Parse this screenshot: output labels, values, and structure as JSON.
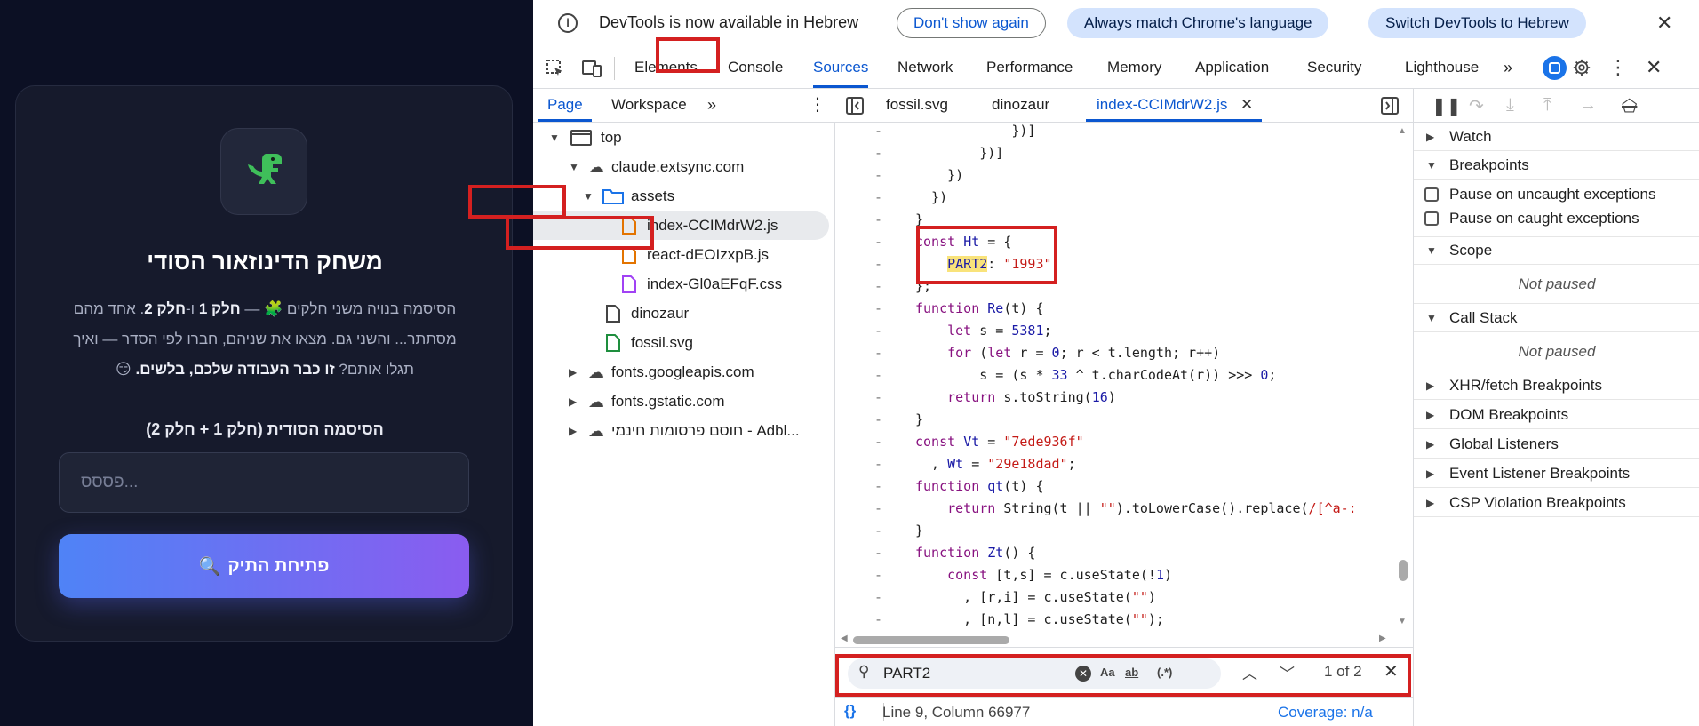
{
  "game": {
    "title": "משחק הדינוזאור הסודי",
    "desc_line1": "הסיסמה בנויה משני חלקים 🧩 — ",
    "desc_part1": "חלק 1",
    "desc_and": " ו-",
    "desc_part2": "חלק 2",
    "desc_line1_end": ". אחד מהם",
    "desc_line2": "מסתתר... והשני גם. מצאו את שניהם, חברו לפי הסדר — ואיך",
    "desc_line3_start": "תגלו אותם? ",
    "desc_bold": "זו כבר העבודה שלכם, בלשים.",
    "desc_emoji": " 😏",
    "pw_label": "הסיסמה הסודית (חלק 1 + חלק 2)",
    "pw_placeholder": "פססס...",
    "button_label": "פתיחת התיק",
    "button_icon": "🔍"
  },
  "infobar": {
    "text": "DevTools is now available in Hebrew",
    "dont_show": "Don't show again",
    "always_match": "Always match Chrome's language",
    "switch": "Switch DevTools to Hebrew"
  },
  "tabs": [
    "Elements",
    "Console",
    "Sources",
    "Network",
    "Performance",
    "Memory",
    "Application",
    "Security",
    "Lighthouse"
  ],
  "active_tab": "Sources",
  "nav_tabs": {
    "page": "Page",
    "workspace": "Workspace"
  },
  "tree": {
    "top": "top",
    "domain": "claude.extsync.com",
    "assets": "assets",
    "file_index_js": "index-CCIMdrW2.js",
    "file_react": "react-dEOIzxpB.js",
    "file_css": "index-Gl0aEFqF.css",
    "file_dinozaur": "dinozaur",
    "file_fossil": "fossil.svg",
    "fonts_googleapis": "fonts.googleapis.com",
    "fonts_gstatic": "fonts.gstatic.com",
    "adblock": "חוסם פרסומות חינמי - Adbl..."
  },
  "editor_tabs": [
    "fossil.svg",
    "dinozaur",
    "index-CCIMdrW2.js"
  ],
  "code": {
    "l1": "            })]",
    "l2": "        })]",
    "l3": "    })",
    "l4": "  })",
    "l5": "}",
    "l6_kw": "const",
    "l6_var": "Ht",
    "l6_rest": " = {",
    "l7_key": "PART2",
    "l7_val": "\"1993\"",
    "l8": "};",
    "l9_kw": "function",
    "l9_name": "Re",
    "l9_rest": "(t) {",
    "l10_kw": "let",
    "l10_rest": " s = ",
    "l10_num": "5381",
    "l11_kw": "for",
    "l11_rest1": " (",
    "l11_kw2": "let",
    "l11_rest2": " r = ",
    "l11_num": "0",
    "l11_rest3": "; r < t.length; r++)",
    "l12_rest1": "s = (s * ",
    "l12_num": "33",
    "l12_rest2": " ^ t.charCodeAt(r)) >>> ",
    "l12_num2": "0",
    "l12_end": ";",
    "l13_kw": "return",
    "l13_rest1": " s.toString(",
    "l13_num": "16",
    "l13_end": ")",
    "l14": "}",
    "l15_kw": "const",
    "l15_var": "Vt",
    "l15_rest": " = ",
    "l15_str": "\"7ede936f\"",
    "l16_rest": "  , ",
    "l16_var": "Wt",
    "l16_rest2": " = ",
    "l16_str": "\"29e18dad\"",
    "l16_end": ";",
    "l17_kw": "function",
    "l17_name": "qt",
    "l17_rest": "(t) {",
    "l18_kw": "return",
    "l18_rest": " String(t || ",
    "l18_str": "\"\"",
    "l18_rest2": ").toLowerCase().replace(",
    "l18_re": "/[^a-:",
    "l19": "}",
    "l20_kw": "function",
    "l20_name": "Zt",
    "l20_rest": "() {",
    "l21_kw": "const",
    "l21_rest": " [t,s] = c.useState(!",
    "l21_num": "1",
    "l21_end": ")",
    "l22_rest": "  , [r,i] = c.useState(",
    "l22_str": "\"\"",
    "l22_end": ")",
    "l23_rest": "  , [n,l] = c.useState(",
    "l23_str": "\"\"",
    "l23_end": ");"
  },
  "search": {
    "query": "PART2",
    "aa": "Aa",
    "ab": "ab",
    "regex": "(.*)",
    "count": "1 of 2"
  },
  "status": {
    "braces": "{}",
    "position": "Line 9, Column 66977",
    "coverage": "Coverage: n/a"
  },
  "sidebar": {
    "watch": "Watch",
    "breakpoints": "Breakpoints",
    "pause_uncaught": "Pause on uncaught exceptions",
    "pause_caught": "Pause on caught exceptions",
    "scope": "Scope",
    "not_paused_1": "Not paused",
    "call_stack": "Call Stack",
    "not_paused_2": "Not paused",
    "xhr": "XHR/fetch Breakpoints",
    "dom": "DOM Breakpoints",
    "global": "Global Listeners",
    "event": "Event Listener Breakpoints",
    "csp": "CSP Violation Breakpoints"
  },
  "colors": {
    "accent": "#0b57d0",
    "highlight_box": "#d42020",
    "game_bg": "#0c1024"
  }
}
